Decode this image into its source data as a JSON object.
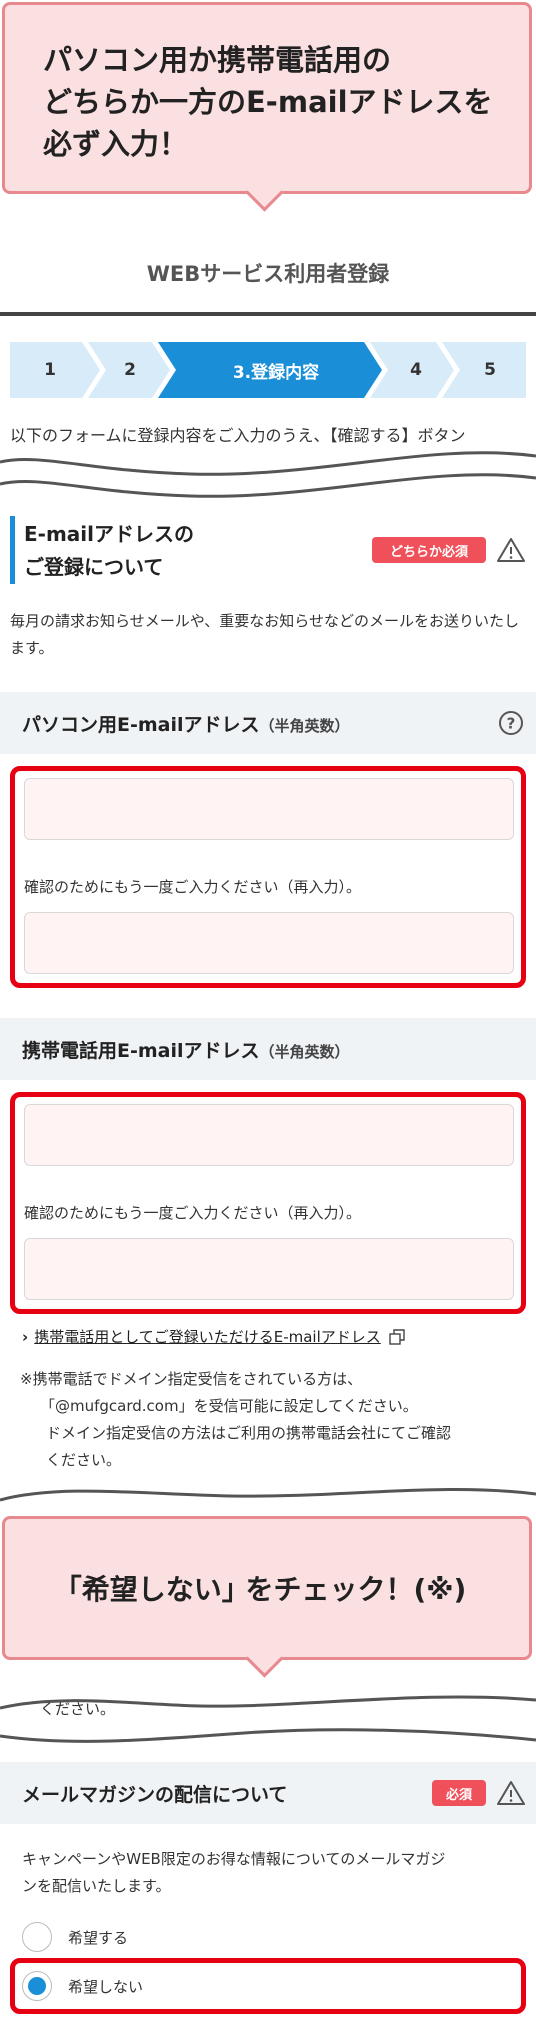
{
  "callout_top": {
    "line1": "パソコン用か携帯電話用の",
    "line2": "どちらか一方のE-mailアドレスを",
    "line3": "必ず入力！"
  },
  "header": {
    "title": "WEBサービス利用者登録"
  },
  "steps": [
    "1",
    "2",
    "3.登録内容",
    "4",
    "5"
  ],
  "intro": {
    "text": "以下のフォームに登録内容をご入力のうえ、【確認する】ボタン"
  },
  "email_section": {
    "heading_line1": "E-mailアドレスの",
    "heading_line2": "ご登録について",
    "badge": "どちらか必須",
    "description": "毎月の請求お知らせメールや、重要なお知らせなどのメールをお送りいたします。"
  },
  "pc_email": {
    "title": "パソコン用E-mailアドレス",
    "note": "（半角英数）",
    "value": "",
    "confirm_label": "確認のためにもう一度ご入力ください（再入力）。",
    "confirm_value": ""
  },
  "mobile_email": {
    "title": "携帯電話用E-mailアドレス",
    "note": "（半角英数）",
    "value": "",
    "confirm_label": "確認のためにもう一度ご入力ください（再入力）。",
    "confirm_value": ""
  },
  "mobile_link": {
    "text": "携帯電話用としてご登録いただけるE-mailアドレス"
  },
  "notes": {
    "line1": "※携帯電話でドメイン指定受信をされている方は、",
    "line2": "「@mufgcard.com」を受信可能に設定してください。",
    "line3": "ドメイン指定受信の方法はご利用の携帯電話会社にてご確認",
    "line4": "ください。"
  },
  "callout_mid": {
    "text": "｢希望しない｣ をチェック！(※)"
  },
  "fragment_text": "ください。",
  "magazine": {
    "title": "メールマガジンの配信について",
    "badge": "必須",
    "description_line1": "キャンペーンやWEB限定のお得な情報についてのメールマガジ",
    "description_line2": "ンを配信いたします。",
    "options": [
      {
        "label": "希望する",
        "selected": false
      },
      {
        "label": "希望しない",
        "selected": true
      }
    ]
  },
  "colors": {
    "accent_blue": "#1a8fd8",
    "step_light": "#d7ebf8",
    "alert_red": "#e60012",
    "badge_red": "#f0505a",
    "callout_pink": "#fbe0e2"
  }
}
